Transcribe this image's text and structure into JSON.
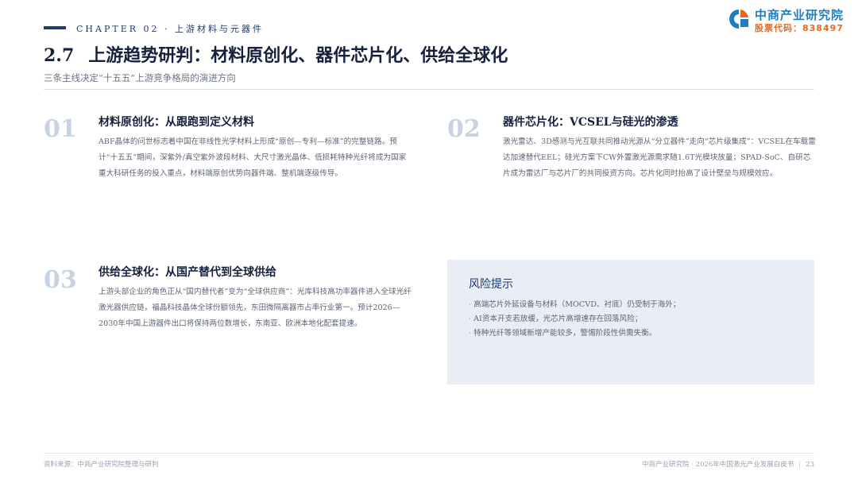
{
  "header": {
    "chapter": "CHAPTER 02 · 上游材料与元器件",
    "logo_name": "中商产业研究院",
    "logo_code": "股票代码：838497"
  },
  "page": {
    "section_no": "2.7",
    "title": "上游趋势研判：材料原创化、器件芯片化、供给全球化",
    "subtitle": "三条主线决定“十五五”上游竞争格局的演进方向"
  },
  "blocks": [
    {
      "num": "01",
      "title": "材料原创化：从跟跑到定义材料",
      "body": "ABF晶体的问世标志着中国在非线性光学材料上形成“原创—专利—标准”的完整链路。预计“十五五”期间，深紫外/真空紫外波段材料、大尺寸激光晶体、低损耗特种光纤将成为国家重大科研任务的投入重点，材料端原创优势向器件端、整机端逐级传导。"
    },
    {
      "num": "02",
      "title": "器件芯片化：VCSEL与硅光的渗透",
      "body": "激光雷达、3D感测与光互联共同推动光源从“分立器件”走向“芯片级集成”：VCSEL在车载雷达加速替代EEL；硅光方案下CW外置激光源需求随1.6T光模块放量；SPAD-SoC、自研芯片成为雷达厂与芯片厂的共同投资方向。芯片化同时抬高了设计壁垒与规模效应。"
    },
    {
      "num": "03",
      "title": "供给全球化：从国产替代到全球供给",
      "body": "上游头部企业的角色正从“国内替代者”变为“全球供应商”：光库科技高功率器件进入全球光纤激光器供应链，福晶科技晶体全球份额领先，东田微隔离器市占率行业第一。预计2026—2030年中国上游器件出口将保持两位数增长，东南亚、欧洲本地化配套提速。"
    }
  ],
  "risk": {
    "title": "风险提示",
    "items": [
      "高端芯片外延设备与材料（MOCVD、衬底）仍受制于海外；",
      "AI资本开支若放缓，光芯片高增速存在回落风险；",
      "特种光纤等领域新增产能较多，警惕阶段性供需失衡。"
    ]
  },
  "footer": {
    "source": "资料来源：中商产业研究院整理与研判",
    "publisher": "中商产业研究院 · 2026年中国激光产业发展白皮书",
    "separator": "|",
    "page_no": "23"
  },
  "colors": {
    "accent_navy": "#1f3a6b",
    "logo_blue": "#1d7fc1",
    "logo_orange": "#e46a1f",
    "number_gray": "#c7d2e2",
    "risk_bg": "#e9edf6"
  }
}
